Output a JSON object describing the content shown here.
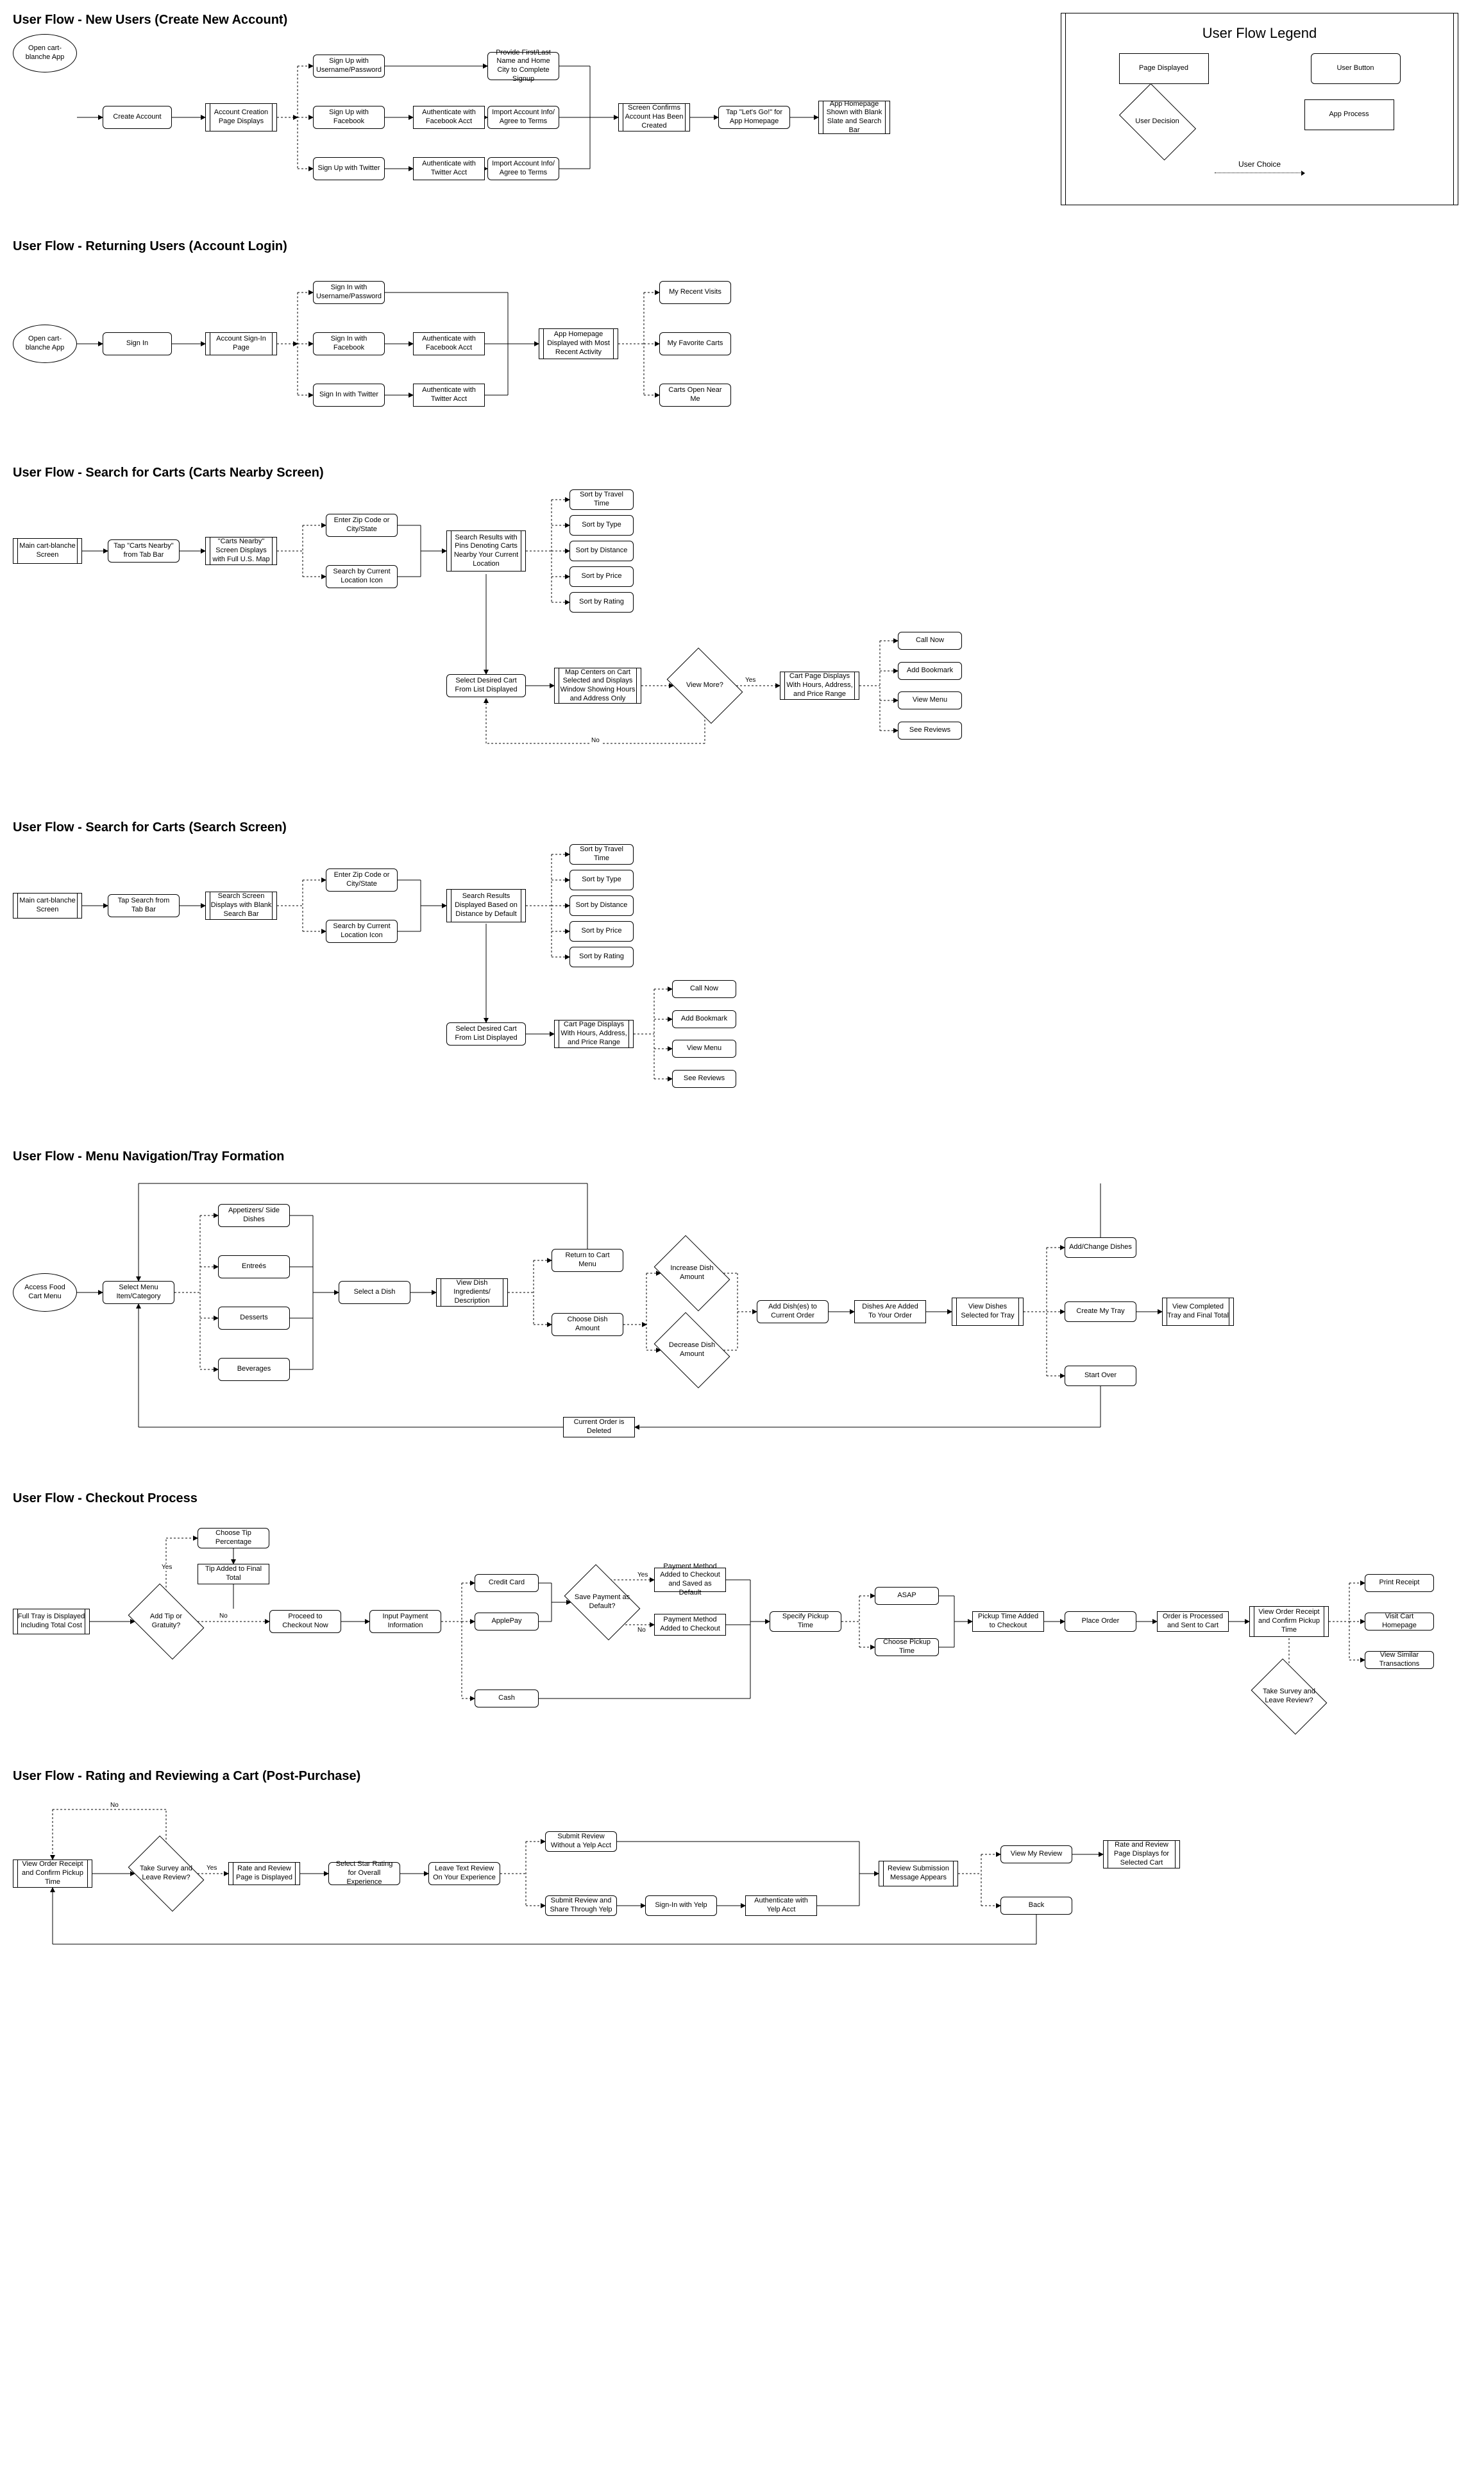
{
  "legend": {
    "title": "User Flow Legend",
    "page": "Page Displayed",
    "button": "User Button",
    "decision": "User Decision",
    "process": "App Process",
    "choice": "User Choice"
  },
  "s1": {
    "title": "User Flow - New Users (Create New Account)",
    "n": {
      "open": "Open cart-blanche App",
      "create": "Create Account",
      "pageCreate": "Account Creation Page Displays",
      "signUser": "Sign Up with Username/Password",
      "signFb": "Sign Up with Facebook",
      "signTw": "Sign Up with Twitter",
      "authFb": "Authenticate with Facebook Acct",
      "authTw": "Authenticate with Twitter Acct",
      "provide": "Provide First/Last Name and Home City to Complete Signup",
      "importFb": "Import Account Info/ Agree to Terms",
      "importTw": "Import Account Info/ Agree to Terms",
      "confirm": "Screen Confirms Account Has Been Created",
      "letsgo": "Tap \"Let's Go!\" for App Homepage",
      "home": "App Homepage Shown with Blank Slate and Search Bar"
    }
  },
  "s2": {
    "title": "User Flow - Returning Users (Account Login)",
    "n": {
      "open": "Open cart-blanche App",
      "signin": "Sign In",
      "page": "Account Sign-In Page",
      "siUser": "Sign In with Username/Password",
      "siFb": "Sign In with Facebook",
      "siTw": "Sign In with Twitter",
      "authFb": "Authenticate with Facebook Acct",
      "authTw": "Authenticate with Twitter Acct",
      "home": "App Homepage Displayed with Most Recent Activity",
      "recent": "My Recent Visits",
      "fav": "My Favorite Carts",
      "near": "Carts Open Near Me"
    }
  },
  "s3": {
    "title": "User Flow - Search for Carts (Carts Nearby Screen)",
    "n": {
      "main": "Main cart-blanche Screen",
      "tap": "Tap \"Carts Nearby\" from Tab Bar",
      "nearby": "\"Carts Nearby\" Screen Displays with Full U.S. Map",
      "zip": "Enter Zip Code or City/State",
      "loc": "Search by Current Location Icon",
      "results": "Search Results with Pins Denoting Carts Nearby Your Current Location",
      "sortTravel": "Sort by Travel Time",
      "sortType": "Sort by Type",
      "sortDist": "Sort by Distance",
      "sortPrice": "Sort by Price",
      "sortRating": "Sort by Rating",
      "select": "Select Desired Cart From List Displayed",
      "map": "Map Centers on Cart Selected and Displays Window Showing Hours and Address Only",
      "viewMore": "View More?",
      "cartPage": "Cart Page Displays With Hours, Address, and Price Range",
      "call": "Call Now",
      "bookmark": "Add Bookmark",
      "menu": "View Menu",
      "reviews": "See Reviews",
      "yes": "Yes",
      "no": "No"
    }
  },
  "s4": {
    "title": "User Flow - Search for Carts (Search Screen)",
    "n": {
      "main": "Main cart-blanche Screen",
      "tap": "Tap Search from Tab Bar",
      "search": "Search Screen Displays with Blank Search Bar",
      "zip": "Enter Zip Code or City/State",
      "loc": "Search by Current Location Icon",
      "results": "Search Results Displayed Based on Distance by Default",
      "sortTravel": "Sort by Travel Time",
      "sortType": "Sort by Type",
      "sortDist": "Sort by Distance",
      "sortPrice": "Sort by Price",
      "sortRating": "Sort by Rating",
      "select": "Select Desired Cart From List Displayed",
      "cartPage": "Cart Page Displays With Hours, Address, and Price Range",
      "call": "Call Now",
      "bookmark": "Add Bookmark",
      "menu": "View Menu",
      "reviews": "See Reviews"
    }
  },
  "s5": {
    "title": "User Flow - Menu Navigation/Tray Formation",
    "n": {
      "access": "Access Food Cart Menu",
      "selectCat": "Select Menu Item/Category",
      "apps": "Appetizers/ Side Dishes",
      "entrees": "Entreés",
      "desserts": "Desserts",
      "bev": "Beverages",
      "selectDish": "Select a Dish",
      "viewDesc": "View Dish Ingredients/ Description",
      "return": "Return to Cart Menu",
      "choose": "Choose Dish Amount",
      "inc": "Increase Dish Amount",
      "dec": "Decrease Dish Amount",
      "add": "Add Dish(es) to Current Order",
      "added": "Dishes Are Added To Your Order",
      "viewDishes": "View Dishes Selected for Tray",
      "change": "Add/Change Dishes",
      "createTray": "Create My Tray",
      "startOver": "Start Over",
      "viewTray": "View Completed Tray and Final Total",
      "deleted": "Current Order is Deleted"
    }
  },
  "s6": {
    "title": "User Flow - Checkout Process",
    "n": {
      "fullTray": "Full Tray is Displayed Including Total Cost",
      "addTip": "Add Tip or Gratuity?",
      "chooseTip": "Choose Tip Percentage",
      "tipAdded": "Tip Added to Final Total",
      "proceed": "Proceed to Checkout Now",
      "input": "Input Payment Information",
      "credit": "Credit Card",
      "apple": "ApplePay",
      "cash": "Cash",
      "saveDef": "Save Payment as Default?",
      "pmDefault": "Payment Method Added to Checkout and Saved as Default",
      "pmAdded": "Payment Method Added to Checkout",
      "specify": "Specify Pickup Time",
      "asap": "ASAP",
      "choosePickup": "Choose Pickup Time",
      "pickupAdded": "Pickup Time Added to Checkout",
      "place": "Place Order",
      "processed": "Order is Processed and Sent to Cart",
      "receipt": "View Order Receipt and Confirm Pickup Time",
      "survey": "Take Survey and Leave Review?",
      "print": "Print Receipt",
      "visit": "Visit Cart Homepage",
      "similar": "View Similar Transactions",
      "yes": "Yes",
      "no": "No"
    }
  },
  "s7": {
    "title": "User Flow - Rating and Reviewing a Cart (Post-Purchase)",
    "n": {
      "receipt": "View Order Receipt and Confirm Pickup Time",
      "survey": "Take Survey and Leave Review?",
      "ratePage": "Rate and Review Page is Displayed",
      "selectStar": "Select Star Rating for Overall Experience",
      "leaveText": "Leave Text Review On Your Experience",
      "submitNoYelp": "Submit Review Without a Yelp Acct",
      "submitYelp": "Submit Review and Share Through Yelp",
      "signYelp": "Sign-In with Yelp",
      "authYelp": "Authenticate with Yelp Acct",
      "msg": "Review Submission Message Appears",
      "viewMy": "View My Review",
      "back": "Back",
      "final": "Rate and Review Page Displays for Selected Cart",
      "yes": "Yes",
      "no": "No"
    }
  }
}
